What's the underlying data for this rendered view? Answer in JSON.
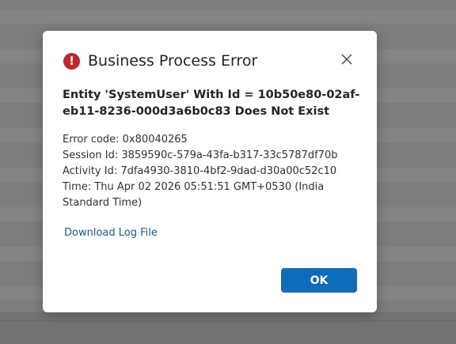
{
  "dialog": {
    "title": "Business Process Error",
    "icon": "error-circle-icon",
    "close_icon": "close-icon",
    "message": "Entity 'SystemUser' With Id = 10b50e80-02af-eb11-8236-000d3a6b0c83 Does Not Exist",
    "details": {
      "error_code": "Error code: 0x80040265",
      "session_id": "Session Id: 3859590c-579a-43fa-b317-33c5787df70b",
      "activity_id": "Activity Id: 7dfa4930-3810-4bf2-9dad-d30a00c52c10",
      "time": "Time: Thu Apr 02 2026 05:51:51 GMT+0530 (India Standard Time)"
    },
    "download_link": "Download Log File",
    "ok_label": "OK"
  },
  "colors": {
    "error_icon": "#c4262e",
    "link": "#115ea3",
    "primary_button": "#0f6cbd",
    "overlay": "#7d7d7d"
  }
}
